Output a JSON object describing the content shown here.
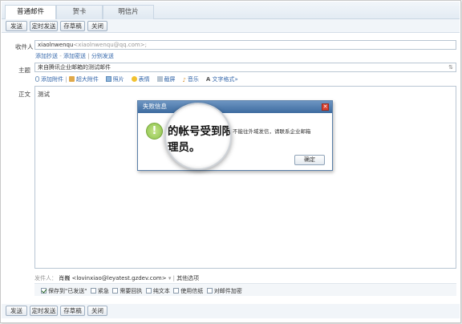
{
  "tabs": [
    "普通邮件",
    "贺卡",
    "明信片"
  ],
  "toolbar": {
    "send": "发送",
    "scheduled_send": "定时发送",
    "save_draft": "存草稿",
    "close": "关闭"
  },
  "recipient": {
    "label": "收件人",
    "value": "xiaolnwenqu",
    "value_suffix": "<xiaolnwenqu@qq.com>;",
    "add_cc": "添加抄送",
    "add_bcc": "添加密送",
    "separate_send": "分别发送"
  },
  "subject": {
    "label": "主题",
    "value": "来自腾讯企业邮箱的测试邮件"
  },
  "attach_bar": {
    "add_attachment": "添加附件",
    "large_attachment": "超大附件",
    "photo": "照片",
    "emoji": "表情",
    "screenshot": "截屏",
    "music": "音乐",
    "text_format": "文字格式"
  },
  "body": {
    "label": "正文",
    "text": "测试"
  },
  "sender": {
    "label": "发件人：",
    "name": "肖巍",
    "email": "<lovinxiao@leyatest.gzdev.com>",
    "other_options": "其他选项"
  },
  "options": [
    {
      "label": "保存到\"已发送\"",
      "checked": true
    },
    {
      "label": "紧急",
      "checked": false
    },
    {
      "label": "需要回执",
      "checked": false
    },
    {
      "label": "纯文本",
      "checked": false
    },
    {
      "label": "使用信纸",
      "checked": false
    },
    {
      "label": "对邮件加密",
      "checked": false
    }
  ],
  "dialog": {
    "title": "失败信息",
    "message_big_line1": "的帐号受到限制",
    "message_small_line1": "不能往外域发信，请联系企业邮箱",
    "message_big_line2": "理员。",
    "ok": "确定"
  },
  "colors": {
    "accent": "#3366aa",
    "dialog_title": "#4a76a8",
    "warning": "#8bc34a"
  }
}
